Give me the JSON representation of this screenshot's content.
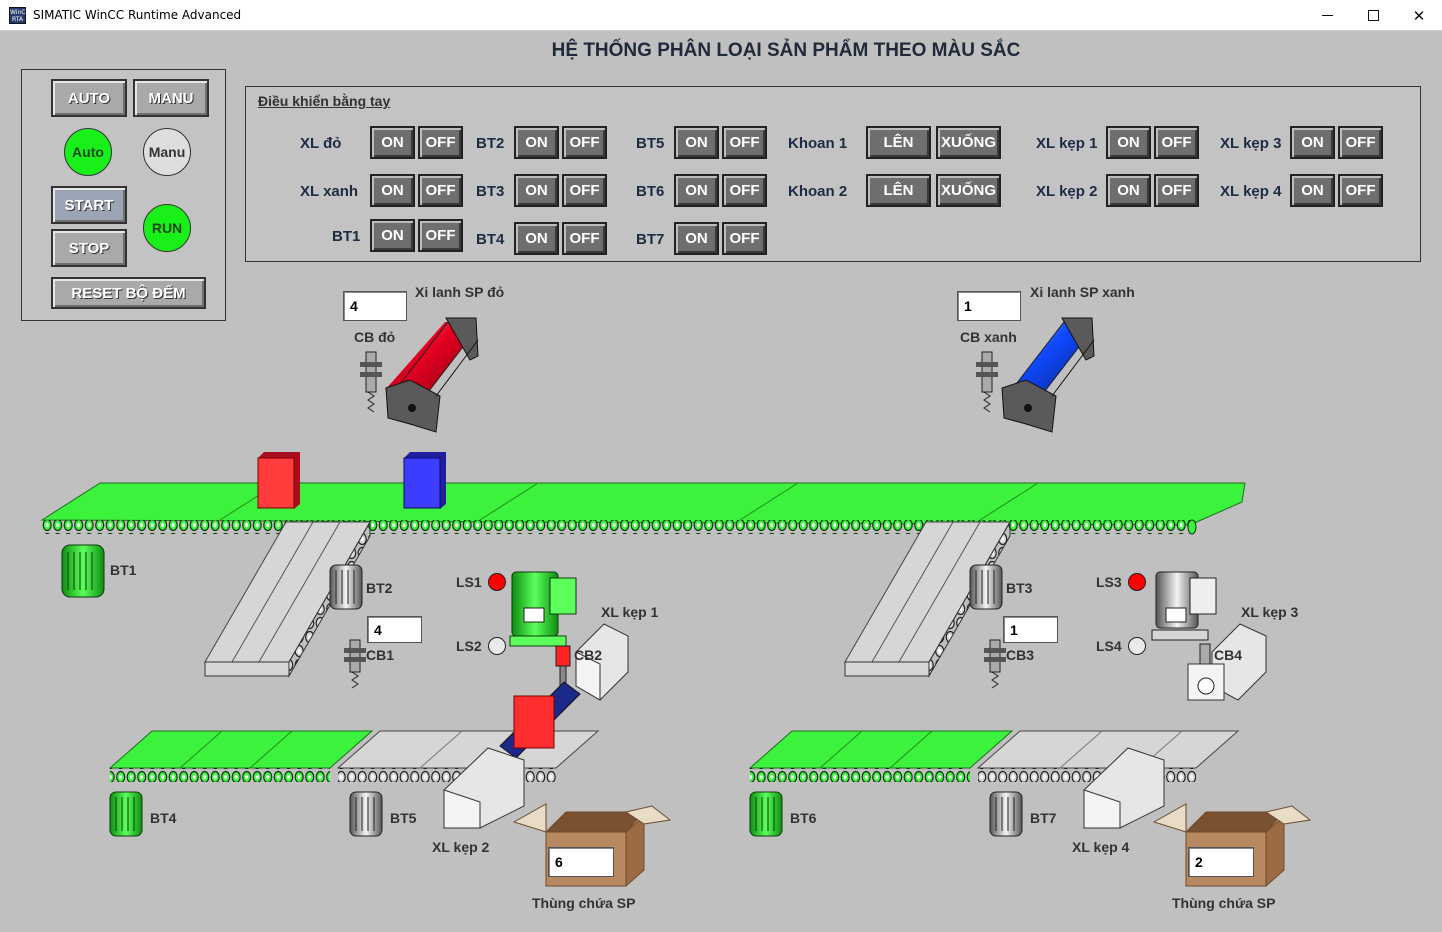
{
  "window": {
    "title": "SIMATIC WinCC Runtime Advanced",
    "icon_text": "WinCC RTA",
    "minimize_icon": "minimize-icon",
    "maximize_icon": "maximize-icon",
    "close_icon": "close-icon"
  },
  "header": {
    "title": "HỆ THỐNG PHÂN LOẠI SẢN PHẨM THEO MÀU SẮC"
  },
  "mode_panel": {
    "auto_button": "AUTO",
    "manu_button": "MANU",
    "auto_lamp": "Auto",
    "manu_lamp": "Manu",
    "start_button": "START",
    "stop_button": "STOP",
    "run_lamp": "RUN",
    "reset_button": "RESET BỘ ĐẾM",
    "auto_lamp_color": "#19f019",
    "run_lamp_color": "#19f019"
  },
  "manual": {
    "title": "Điều khiển bằng tay",
    "on": "ON",
    "off": "OFF",
    "up": "LÊN",
    "down": "XUỐNG",
    "labels": {
      "xl_do": "XL đỏ",
      "xl_xanh": "XL xanh",
      "bt1": "BT1",
      "bt2": "BT2",
      "bt3": "BT3",
      "bt4": "BT4",
      "bt5": "BT5",
      "bt6": "BT6",
      "bt7": "BT7",
      "khoan1": "Khoan 1",
      "khoan2": "Khoan 2",
      "xl_kep1": "XL kẹp 1",
      "xl_kep2": "XL kẹp 2",
      "xl_kep3": "XL kẹp 3",
      "xl_kep4": "XL kẹp 4"
    }
  },
  "process": {
    "cylinder_red_label": "Xi lanh SP đỏ",
    "cylinder_blue_label": "Xi lanh SP xanh",
    "cb_do_label": "CB đỏ",
    "cb_xanh_label": "CB xanh",
    "cb_do_count": "4",
    "cb_xanh_count": "1",
    "cb1_label": "CB1",
    "cb1_count": "4",
    "cb2_label": "CB2",
    "cb3_label": "CB3",
    "cb3_count": "1",
    "cb4_label": "CB4",
    "bt1": "BT1",
    "bt2": "BT2",
    "bt3": "BT3",
    "bt4": "BT4",
    "bt5": "BT5",
    "bt6": "BT6",
    "bt7": "BT7",
    "ls1": "LS1",
    "ls2": "LS2",
    "ls3": "LS3",
    "ls4": "LS4",
    "xl_kep1": "XL kẹp 1",
    "xl_kep2": "XL kẹp 2",
    "xl_kep3": "XL kẹp 3",
    "xl_kep4": "XL kẹp 4",
    "bin_red_label": "Thùng chứa SP",
    "bin_red_count": "6",
    "bin_blue_label": "Thùng chứa SP",
    "bin_blue_count": "2",
    "ls1_state_color": "#ff0000",
    "ls2_state_color": "#eaeaea",
    "ls3_state_color": "#ff0000",
    "ls4_state_color": "#eaeaea",
    "conveyor_active_color": "#3cf23c",
    "conveyor_idle_color": "#d6d6d6"
  }
}
